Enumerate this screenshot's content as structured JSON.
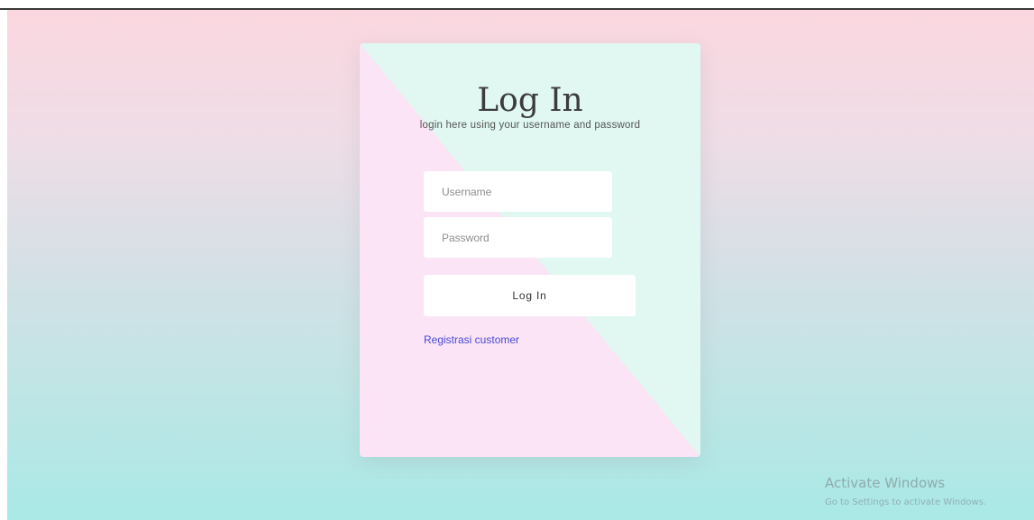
{
  "login": {
    "title": "Log In",
    "subtitle": "login here using your username and password",
    "username_placeholder": "Username",
    "password_placeholder": "Password",
    "submit_label": "Log In",
    "register_link": "Registrasi customer"
  },
  "watermark": {
    "title": "Activate Windows",
    "subtitle": "Go to Settings to activate Windows."
  },
  "colors": {
    "background_top": "#fbd7e0",
    "background_bottom": "#a9e9e6",
    "card_mint": "#e0f8f1",
    "card_pink": "#fbe4f6",
    "link": "#4a4ad8"
  }
}
